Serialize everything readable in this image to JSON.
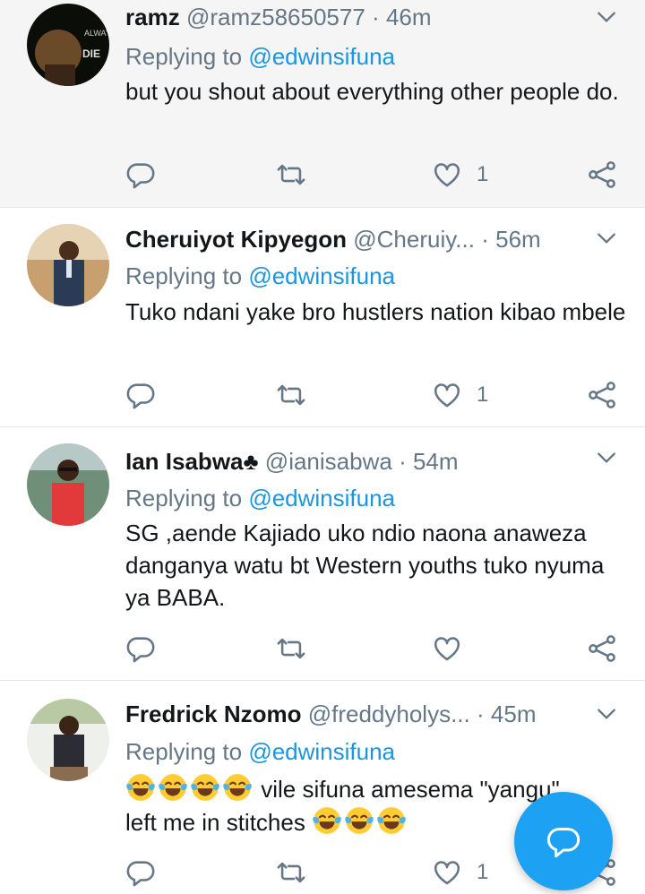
{
  "colors": {
    "accent": "#1b95e0",
    "secondary_text": "#657786",
    "highlight_bg": "#f5f5f5",
    "fab": "#1da1f2"
  },
  "tweets": [
    {
      "name": "ramz",
      "handle": "@ramz58650577",
      "separator": "·",
      "time": "46m",
      "replying_prefix": "Replying to ",
      "replying_to": "@edwinsifuna",
      "text": "but you shout about everything other people do.",
      "likes": "1",
      "avatar_text_1": "ALWAYS",
      "avatar_text_2": "DIE",
      "icons": [
        "reply-icon",
        "retweet-icon",
        "like-icon",
        "share-icon",
        "chevron-down-icon"
      ]
    },
    {
      "name": "Cheruiyot Kipyegon",
      "handle": "@Cheruiy...",
      "separator": "·",
      "time": "56m",
      "replying_prefix": "Replying to ",
      "replying_to": "@edwinsifuna",
      "text": "Tuko ndani yake bro hustlers nation kibao mbele",
      "likes": "1"
    },
    {
      "name": "Ian Isabwa",
      "name_suffix": "♣",
      "handle": "@ianisabwa",
      "separator": "·",
      "time": "54m",
      "replying_prefix": "Replying to ",
      "replying_to": "@edwinsifuna",
      "text": "SG ,aende Kajiado uko ndio naona anaweza danganya watu bt Western youths tuko nyuma ya BABA.",
      "likes": ""
    },
    {
      "name": "Fredrick Nzomo",
      "handle": "@freddyholys...",
      "separator": "·",
      "time": "45m",
      "replying_prefix": "Replying to ",
      "replying_to": "@edwinsifuna",
      "text_line1": "vile sifuna amesema \"yangu\"",
      "text_line2": "left me in stitches",
      "emoji": "face-with-tears-of-joy-icon",
      "likes": "1"
    }
  ],
  "fab": {
    "icon": "compose-reply-icon"
  }
}
